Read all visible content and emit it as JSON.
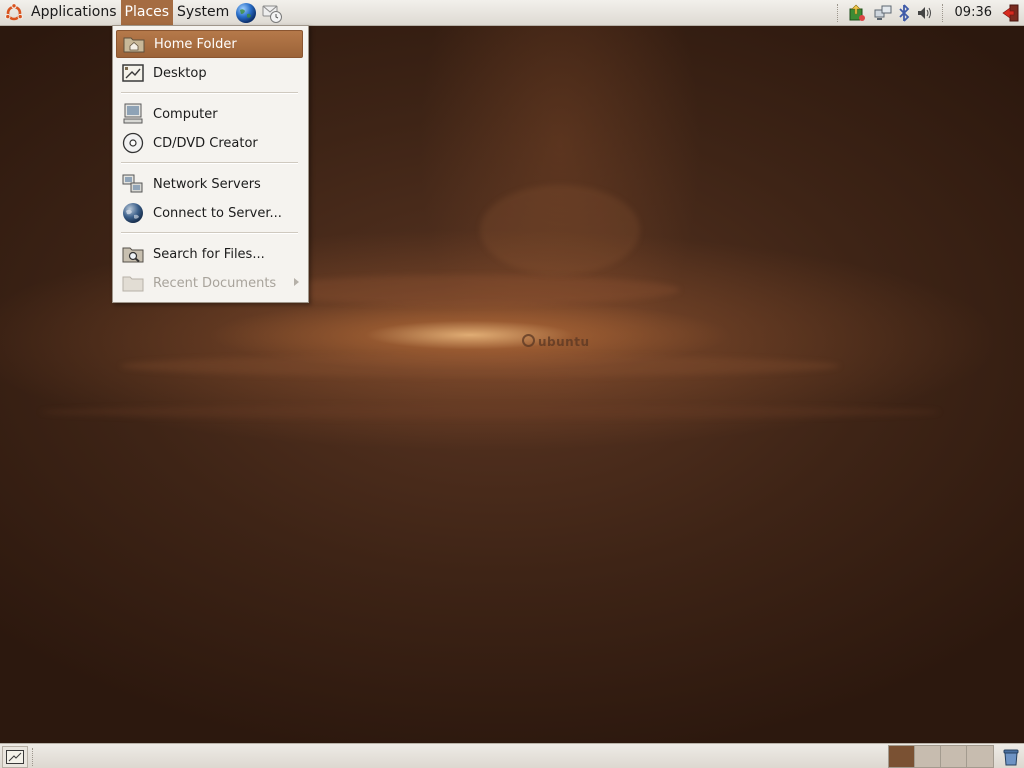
{
  "top_panel": {
    "menus": {
      "applications": "Applications",
      "places": "Places",
      "system": "System"
    },
    "launchers": [
      {
        "icon": "web-browser-globe-icon"
      },
      {
        "icon": "email-client-icon"
      }
    ],
    "tray_icons": [
      "update-notifier-icon",
      "network-icon",
      "bluetooth-icon",
      "volume-icon"
    ],
    "clock": "09:36",
    "quit_icon": "shutdown-icon"
  },
  "places_menu": {
    "items": [
      {
        "label": "Home Folder",
        "icon": "home-folder-icon",
        "highlighted": true
      },
      {
        "label": "Desktop",
        "icon": "desktop-icon"
      },
      {
        "label": "Computer",
        "icon": "computer-icon"
      },
      {
        "label": "CD/DVD Creator",
        "icon": "cd-dvd-icon"
      },
      {
        "label": "Network Servers",
        "icon": "network-servers-icon"
      },
      {
        "label": "Connect to Server...",
        "icon": "globe-icon"
      },
      {
        "label": "Search for Files...",
        "icon": "search-folder-icon"
      },
      {
        "label": "Recent Documents",
        "icon": "folder-icon",
        "disabled": true,
        "submenu": true
      }
    ]
  },
  "wallpaper": {
    "logo_text": "ubuntu"
  },
  "bottom_panel": {
    "workspaces": [
      {
        "current": true
      },
      {
        "current": false
      },
      {
        "current": false
      },
      {
        "current": false
      }
    ],
    "trash_icon": "trash-icon"
  },
  "colors": {
    "accent": "#a56c42",
    "panel": "#e6e2dc",
    "desktop": "#3e2416"
  }
}
